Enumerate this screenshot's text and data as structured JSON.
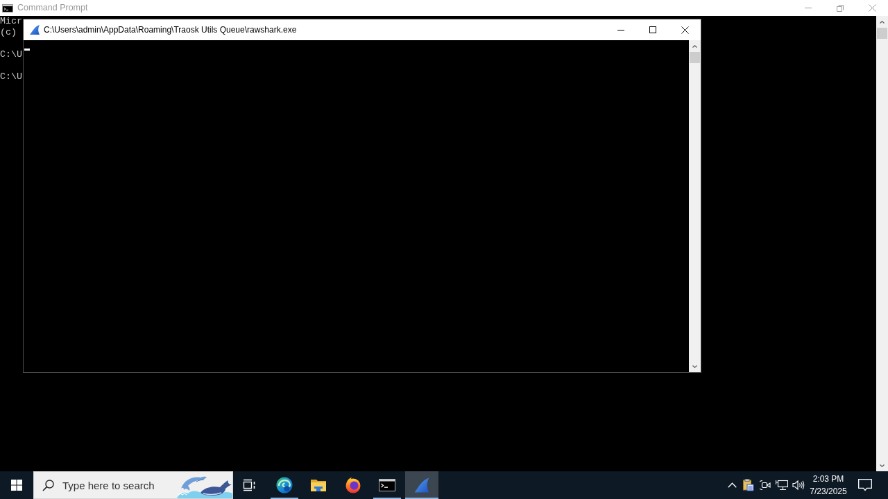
{
  "console_window": {
    "title": "Command Prompt",
    "active": false,
    "maximized": true,
    "output_blocks": [
      [
        "Micr",
        "(c)"
      ],
      [
        "C:\\U"
      ],
      [
        "C:\\U"
      ]
    ]
  },
  "app_window": {
    "title": "C:\\Users\\admin\\AppData\\Roaming\\Traosk Utils Queue\\rawshark.exe",
    "active": true,
    "maximized": false,
    "cursor_visible": true
  },
  "taskbar": {
    "search": {
      "placeholder": "Type here to search"
    },
    "apps": [
      {
        "kind": "taskview",
        "running": false,
        "selected": false
      },
      {
        "kind": "swirl",
        "running": true,
        "selected": false
      },
      {
        "kind": "folder",
        "running": false,
        "selected": false
      },
      {
        "kind": "globe",
        "running": false,
        "selected": false
      },
      {
        "kind": "console",
        "running": true,
        "selected": false
      },
      {
        "kind": "fin",
        "running": true,
        "selected": true
      }
    ],
    "tray": {
      "time": "2:03 PM",
      "date": "7/23/2025"
    }
  }
}
